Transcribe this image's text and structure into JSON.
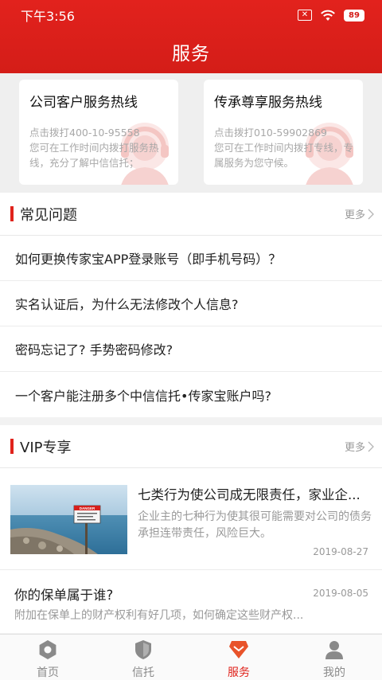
{
  "status_bar": {
    "time": "下午3:56",
    "sim_icon": "sim-disabled-icon",
    "wifi_icon": "wifi-icon",
    "battery": "89"
  },
  "header": {
    "title": "服务"
  },
  "hotlines": [
    {
      "title": "公司客户服务热线",
      "desc_line1": "点击拨打400-10-95558",
      "desc_line2": "您可在工作时间内拨打服务热线，充分了解中信信托；",
      "icon": "customer-service-agent-icon"
    },
    {
      "title": "传承尊享服务热线",
      "desc_line1": "点击拨打010-59902869",
      "desc_line2": "您可在工作时间内拨打专线，专属服务为您守候。",
      "icon": "customer-service-agent-icon"
    }
  ],
  "faq": {
    "title": "常见问题",
    "more": "更多",
    "items": [
      "如何更换传家宝APP登录账号（即手机号码）？",
      "实名认证后，为什么无法修改个人信息?",
      "密码忘记了? 手势密码修改?",
      "一个客户能注册多个中信信托•传家宝账户吗?"
    ]
  },
  "vip": {
    "title": "VIP专享",
    "more": "更多",
    "articles": [
      {
        "title": "七类行为使公司成无限责任，家业企...",
        "summary": "企业主的七种行为使其很可能需要对公司的债务承担连带责任，风险巨大。",
        "date": "2019-08-27",
        "thumb_sign": "DANGER"
      },
      {
        "title": "你的保单属于谁?",
        "summary": "附加在保单上的财产权利有好几项，如何确定这些财产权...",
        "date": "2019-08-05"
      }
    ]
  },
  "tabs": [
    {
      "label": "首页",
      "icon": "home-hexagon-icon",
      "active": false
    },
    {
      "label": "信托",
      "icon": "shield-icon",
      "active": false
    },
    {
      "label": "服务",
      "icon": "service-diamond-icon",
      "active": true
    },
    {
      "label": "我的",
      "icon": "person-icon",
      "active": false
    }
  ],
  "colors": {
    "brand_red": "#e0231c",
    "tab_inactive": "#8a8a8a"
  }
}
